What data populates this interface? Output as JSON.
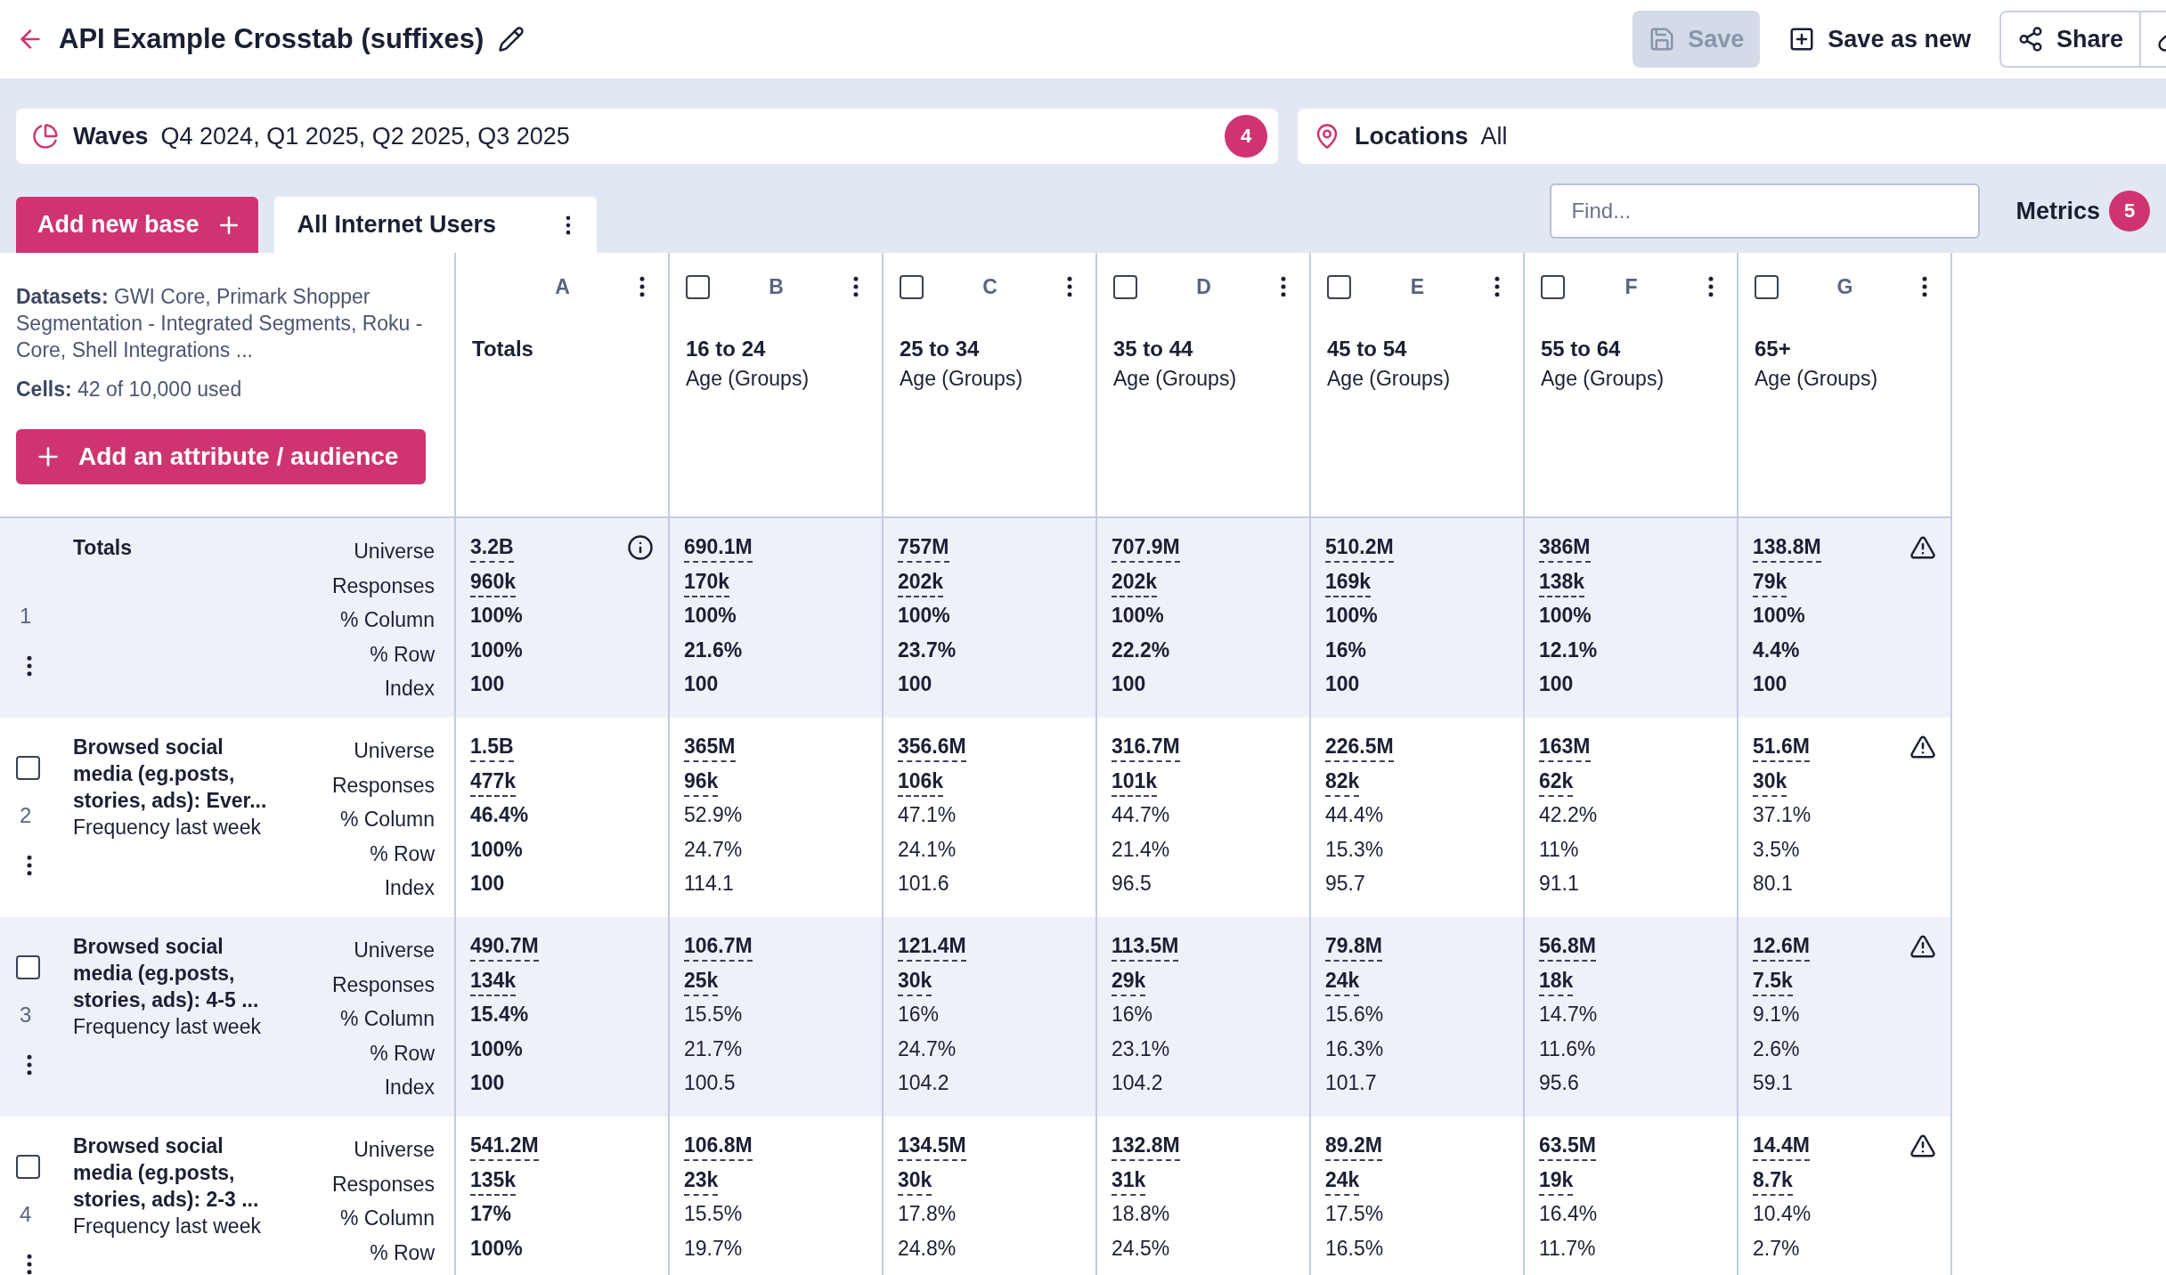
{
  "header": {
    "title": "API Example Crosstab (suffixes)",
    "buttons": [
      {
        "kind": "save",
        "label": "Save",
        "disabled": true
      },
      {
        "kind": "save-new",
        "label": "Save as new",
        "disabled": false
      },
      {
        "kind": "share",
        "label": "Share",
        "disabled": false
      },
      {
        "kind": "link",
        "disabled": false
      }
    ]
  },
  "filters": [
    {
      "kind": "waves",
      "label": "Waves",
      "value": "Q4 2024, Q1 2025, Q2 2025, Q3 2025",
      "count": "4"
    },
    {
      "kind": "locations",
      "label": "Locations",
      "value": "All"
    }
  ],
  "bases": {
    "add_button": "Add new base",
    "tabs": [
      {
        "label": "All Internet Users",
        "selected": true
      }
    ]
  },
  "find": {
    "placeholder": "Find..."
  },
  "metrics": {
    "label": "Metrics",
    "count": "5"
  },
  "info": {
    "datasets": "**Datasets:** GWI Core, Primark Shopper Segmentation - Integrated Segments, Roku - Core, Shell Integrations ...",
    "cells": "**Cells:** 42 of 10,000 used",
    "add_button": "Add an attribute / audience"
  },
  "columns": [
    {
      "kind": "totals",
      "letter": "A",
      "title": "Totals"
    },
    {
      "kind": "attribute",
      "letter": "B",
      "title": "16 to 24",
      "subtitle": "Age (Groups)",
      "checked": false
    },
    {
      "kind": "attribute",
      "letter": "C",
      "title": "25 to 34",
      "subtitle": "Age (Groups)",
      "checked": false
    },
    {
      "kind": "attribute",
      "letter": "D",
      "title": "35 to 44",
      "subtitle": "Age (Groups)",
      "checked": false
    },
    {
      "kind": "attribute",
      "letter": "E",
      "title": "45 to 54",
      "subtitle": "Age (Groups)",
      "checked": false
    },
    {
      "kind": "attribute",
      "letter": "F",
      "title": "55 to 64",
      "subtitle": "Age (Groups)",
      "checked": false
    },
    {
      "kind": "attribute",
      "letter": "G",
      "title": "65+",
      "subtitle": "Age (Groups)",
      "checked": false
    }
  ],
  "rows": [
    {
      "kind": "totals",
      "number": "1",
      "title": "Totals",
      "highlighted": true,
      "metrics": [
        "Universe",
        "Responses",
        "% Column",
        "% Row",
        "Index"
      ],
      "cells": [
        {
          "values": [
            "3.2B",
            "960k",
            "100%",
            "100%",
            "100"
          ],
          "bold": true,
          "kind": "info"
        },
        {
          "values": [
            "690.1M",
            "170k",
            "100%",
            "21.6%",
            "100"
          ],
          "bold": true
        },
        {
          "values": [
            "757M",
            "202k",
            "100%",
            "23.7%",
            "100"
          ],
          "bold": true
        },
        {
          "values": [
            "707.9M",
            "202k",
            "100%",
            "22.2%",
            "100"
          ],
          "bold": true
        },
        {
          "values": [
            "510.2M",
            "169k",
            "100%",
            "16%",
            "100"
          ],
          "bold": true
        },
        {
          "values": [
            "386M",
            "138k",
            "100%",
            "12.1%",
            "100"
          ],
          "bold": true
        },
        {
          "values": [
            "138.8M",
            "79k",
            "100%",
            "4.4%",
            "100"
          ],
          "bold": true,
          "kind": "warning"
        }
      ]
    },
    {
      "kind": "attribute",
      "number": "2",
      "checked": false,
      "title": "Browsed social media (eg.posts, stories, ads): Ever...",
      "subtitle": "Frequency last week",
      "highlighted": false,
      "metrics": [
        "Universe",
        "Responses",
        "% Column",
        "% Row",
        "Index"
      ],
      "cells": [
        {
          "values": [
            "1.5B",
            "477k",
            "46.4%",
            "100%",
            "100"
          ],
          "bold": true
        },
        {
          "values": [
            "365M",
            "96k",
            "52.9%",
            "24.7%",
            "114.1"
          ],
          "bold": false
        },
        {
          "values": [
            "356.6M",
            "106k",
            "47.1%",
            "24.1%",
            "101.6"
          ],
          "bold": false
        },
        {
          "values": [
            "316.7M",
            "101k",
            "44.7%",
            "21.4%",
            "96.5"
          ],
          "bold": false
        },
        {
          "values": [
            "226.5M",
            "82k",
            "44.4%",
            "15.3%",
            "95.7"
          ],
          "bold": false
        },
        {
          "values": [
            "163M",
            "62k",
            "42.2%",
            "11%",
            "91.1"
          ],
          "bold": false
        },
        {
          "values": [
            "51.6M",
            "30k",
            "37.1%",
            "3.5%",
            "80.1"
          ],
          "bold": false,
          "kind": "warning"
        }
      ]
    },
    {
      "kind": "attribute",
      "number": "3",
      "checked": false,
      "title": "Browsed social media (eg.posts, stories, ads): 4-5 ...",
      "subtitle": "Frequency last week",
      "highlighted": true,
      "metrics": [
        "Universe",
        "Responses",
        "% Column",
        "% Row",
        "Index"
      ],
      "cells": [
        {
          "values": [
            "490.7M",
            "134k",
            "15.4%",
            "100%",
            "100"
          ],
          "bold": true
        },
        {
          "values": [
            "106.7M",
            "25k",
            "15.5%",
            "21.7%",
            "100.5"
          ],
          "bold": false
        },
        {
          "values": [
            "121.4M",
            "30k",
            "16%",
            "24.7%",
            "104.2"
          ],
          "bold": false
        },
        {
          "values": [
            "113.5M",
            "29k",
            "16%",
            "23.1%",
            "104.2"
          ],
          "bold": false
        },
        {
          "values": [
            "79.8M",
            "24k",
            "15.6%",
            "16.3%",
            "101.7"
          ],
          "bold": false
        },
        {
          "values": [
            "56.8M",
            "18k",
            "14.7%",
            "11.6%",
            "95.6"
          ],
          "bold": false
        },
        {
          "values": [
            "12.6M",
            "7.5k",
            "9.1%",
            "2.6%",
            "59.1"
          ],
          "bold": false,
          "kind": "warning"
        }
      ]
    },
    {
      "kind": "attribute",
      "number": "4",
      "checked": false,
      "title": "Browsed social media (eg.posts, stories, ads): 2-3 ...",
      "subtitle": "Frequency last week",
      "highlighted": false,
      "metrics": [
        "Universe",
        "Responses",
        "% Column",
        "% Row"
      ],
      "cells": [
        {
          "values": [
            "541.2M",
            "135k",
            "17%",
            "100%"
          ],
          "bold": true
        },
        {
          "values": [
            "106.8M",
            "23k",
            "15.5%",
            "19.7%"
          ],
          "bold": false
        },
        {
          "values": [
            "134.5M",
            "30k",
            "17.8%",
            "24.8%"
          ],
          "bold": false
        },
        {
          "values": [
            "132.8M",
            "31k",
            "18.8%",
            "24.5%"
          ],
          "bold": false
        },
        {
          "values": [
            "89.2M",
            "24k",
            "17.5%",
            "16.5%"
          ],
          "bold": false
        },
        {
          "values": [
            "63.5M",
            "19k",
            "16.4%",
            "11.7%"
          ],
          "bold": false
        },
        {
          "values": [
            "14.4M",
            "8.7k",
            "10.4%",
            "2.7%"
          ],
          "bold": false,
          "kind": "warning"
        }
      ]
    }
  ]
}
